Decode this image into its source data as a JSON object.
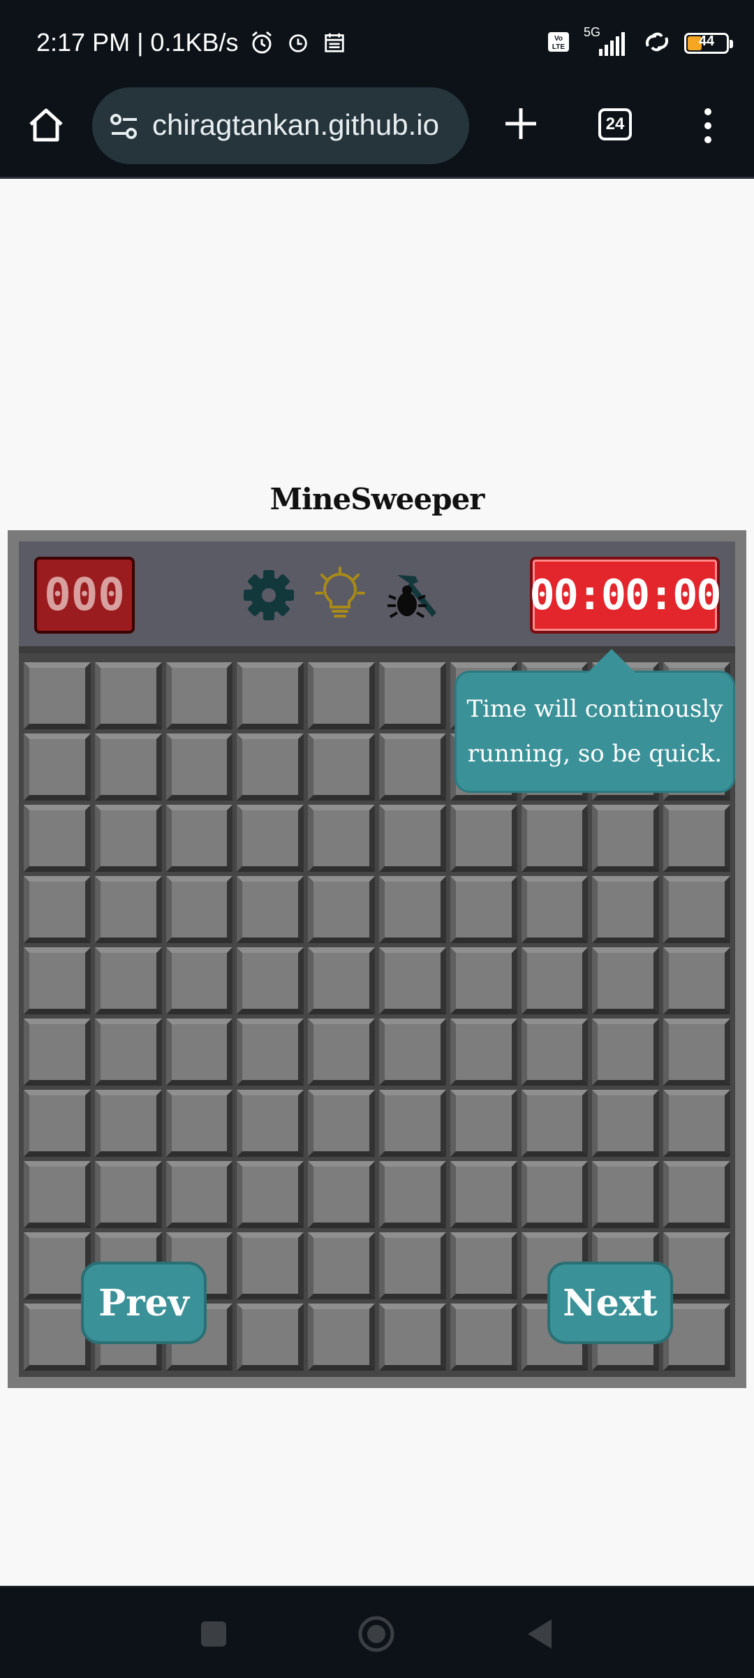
{
  "status_bar": {
    "time_speed": "2:17 PM | 0.1KB/s",
    "network": "5G",
    "volte": "Vo LTE",
    "battery": "44",
    "icons": [
      "alarm-icon",
      "clock-icon",
      "calendar-icon",
      "volte-icon",
      "signal-icon",
      "hotspot-icon",
      "battery-icon"
    ]
  },
  "browser": {
    "url": "chiragtankan.github.io",
    "tab_count": "24",
    "icons": [
      "home-icon",
      "site-settings-icon",
      "new-tab-plus-icon",
      "tab-switcher-icon",
      "menu-dots-icon"
    ]
  },
  "game": {
    "title": "MineSweeper",
    "mine_count": "000",
    "timer": "00:00:00",
    "header_icons": [
      "gear-icon",
      "lightbulb-icon",
      "hammer-bug-icon"
    ],
    "grid": {
      "rows": 10,
      "cols": 10
    },
    "tooltip": {
      "line1": "Time will continously",
      "line2": "running, so be quick."
    },
    "prev_label": "Prev",
    "next_label": "Next"
  },
  "colors": {
    "accent_teal": "#3a9198",
    "counter_red": "#9b1c1f",
    "timer_red": "#e3252c",
    "header_slate": "#5b5b66",
    "tile_gray": "#7d7d7d"
  }
}
